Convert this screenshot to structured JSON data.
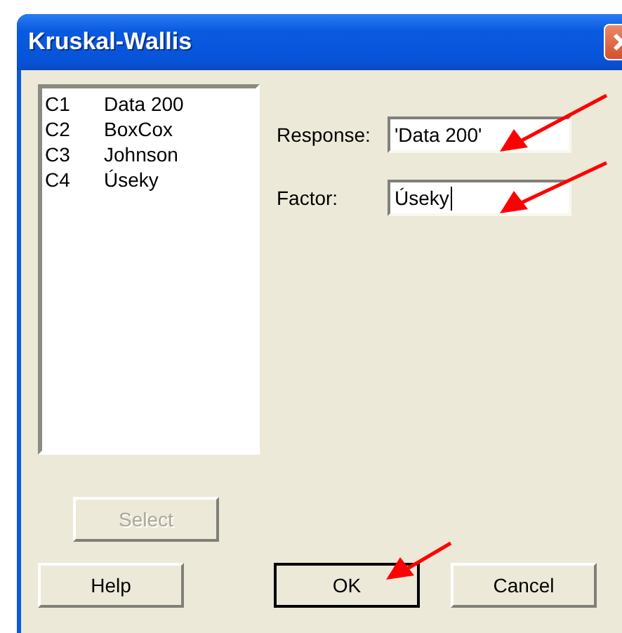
{
  "window": {
    "title": "Kruskal-Wallis"
  },
  "columns": [
    {
      "id": "C1",
      "name": "Data 200"
    },
    {
      "id": "C2",
      "name": "BoxCox"
    },
    {
      "id": "C3",
      "name": "Johnson"
    },
    {
      "id": "C4",
      "name": "Úseky"
    }
  ],
  "fields": [
    {
      "label": "Response:",
      "value": "'Data 200'",
      "focused": false
    },
    {
      "label": "Factor:",
      "value": "Úseky",
      "focused": true
    }
  ],
  "select_button": {
    "label": "Select",
    "disabled": true
  },
  "buttons": [
    {
      "label": "Help",
      "default": false
    },
    {
      "label": "OK",
      "default": true
    },
    {
      "label": "Cancel",
      "default": false
    }
  ]
}
